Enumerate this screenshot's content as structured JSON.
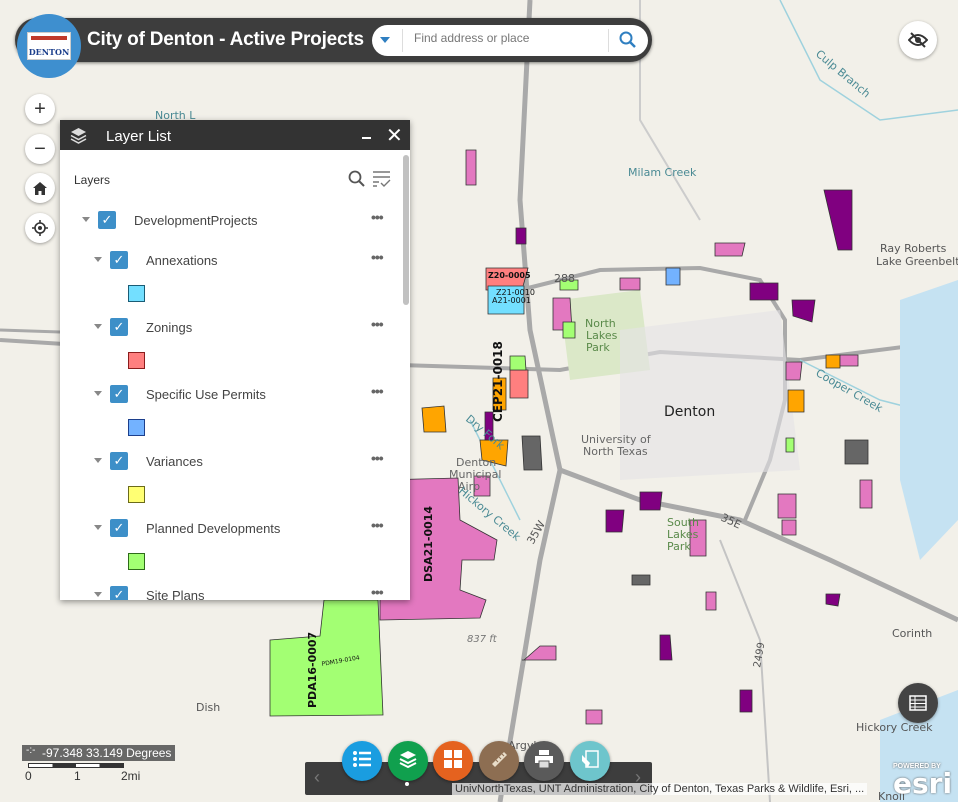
{
  "header": {
    "title": "City of Denton - Active Projects",
    "logo_text": "DENTON",
    "search_placeholder": "Find address or place"
  },
  "map_controls": {
    "zoom_in": "+",
    "zoom_out": "−"
  },
  "layer_list": {
    "title": "Layer List",
    "section_label": "Layers",
    "root": {
      "name": "DevelopmentProjects",
      "checked": true
    },
    "layers": [
      {
        "name": "Annexations",
        "checked": true,
        "swatch": "#73dfff",
        "border": "#1a5c75"
      },
      {
        "name": "Zonings",
        "checked": true,
        "swatch": "#ff7f7f",
        "border": "#8a1c1c"
      },
      {
        "name": "Specific Use Permits",
        "checked": true,
        "swatch": "#73b2ff",
        "border": "#1c3f8c"
      },
      {
        "name": "Variances",
        "checked": true,
        "swatch": "#ffff73",
        "border": "#6b6b1a"
      },
      {
        "name": "Planned Developments",
        "checked": true,
        "swatch": "#a3ff73",
        "border": "#2e6b1a"
      },
      {
        "name": "Site Plans",
        "checked": true
      }
    ]
  },
  "map_labels": {
    "north_lakes_top": "North L",
    "culp_branch": "Culp Branch",
    "milam_creek": "Milam Creek",
    "ray_roberts_1": "Ray Roberts",
    "ray_roberts_2": "Lake Greenbelt",
    "hwy_288": "288",
    "north_lakes_1": "North",
    "north_lakes_2": "Lakes",
    "north_lakes_3": "Park",
    "denton": "Denton",
    "unt_1": "University of",
    "unt_2": "North Texas",
    "airport_1": "Denton",
    "airport_2": "Municipal",
    "airport_3": "Airp",
    "cooper_creek": "Cooper Creek",
    "dry_fork": "Dry Fork",
    "hickory_creek_w": "Hickory Creek",
    "i35w": "35W",
    "i35e": "35E",
    "south_lakes_1": "South",
    "south_lakes_2": "Lakes",
    "south_lakes_3": "Park",
    "elev": "837 ft",
    "corinth": "Corinth",
    "hickory_creek_e": "Hickory Creek",
    "dish": "Dish",
    "argyle": "Argyle",
    "fm2499": "2499",
    "knoll": "Knoll"
  },
  "project_labels": {
    "dsa": "DSA21-0014",
    "pda": "PDA16-0007",
    "pdm": "PDM19-0104",
    "cep": "CEP21-0018",
    "z20": "Z20-0005",
    "z21": "Z21-0010",
    "a21": "A21-0001"
  },
  "footer": {
    "coordinates": "-97.348 33.149 Degrees",
    "scale": [
      "0",
      "1",
      "2mi"
    ],
    "attribution": "UnivNorthTexas, UNT Administration, City of Denton, Texas Parks & Wildlife, Esri, ...",
    "esri_powered": "POWERED BY",
    "esri": "esri"
  },
  "toolbar": {
    "buttons": [
      {
        "name": "legend",
        "color": "#1a9de0"
      },
      {
        "name": "layer-list",
        "color": "#10a04e"
      },
      {
        "name": "basemap-gallery",
        "color": "#e5621f"
      },
      {
        "name": "measurement",
        "color": "#8d6e52"
      },
      {
        "name": "print",
        "color": "#5a5a5a"
      },
      {
        "name": "draw",
        "color": "#6ec5cc"
      }
    ]
  }
}
